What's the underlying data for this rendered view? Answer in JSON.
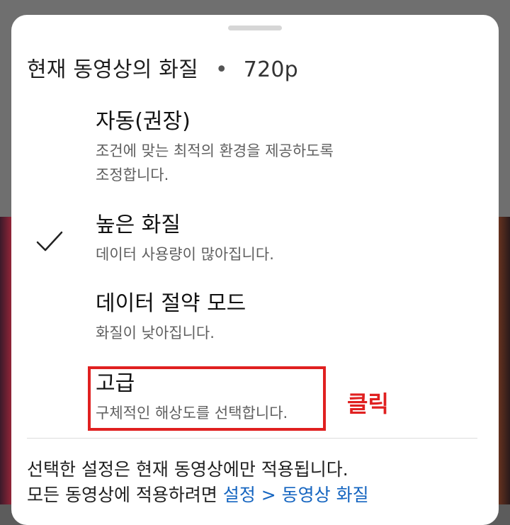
{
  "sheet": {
    "title": "현재 동영상의 화질",
    "separator": "•",
    "current_resolution": "720p"
  },
  "options": [
    {
      "label": "자동(권장)",
      "desc_line1": "조건에 맞는 최적의 환경을 제공하도록",
      "desc_line2": "조정합니다.",
      "selected": false
    },
    {
      "label": "높은 화질",
      "desc_line1": "데이터 사용량이 많아집니다.",
      "selected": true
    },
    {
      "label": "데이터 절약 모드",
      "desc_line1": "화질이 낮아집니다.",
      "selected": false
    },
    {
      "label": "고급",
      "desc_line1": "구체적인 해상도를 선택합니다.",
      "selected": false
    }
  ],
  "footer": {
    "line1": "선택한 설정은 현재 동영상에만 적용됩니다.",
    "line2_prefix": "모든 동영상에 적용하려면 ",
    "line2_link": "설정 > 동영상 화질"
  },
  "annotation": {
    "text": "클릭",
    "color": "#e02020"
  },
  "colors": {
    "link": "#1565c0",
    "annotation_red": "#e02020"
  },
  "icons": {
    "selected_marker": "checkmark-icon"
  }
}
